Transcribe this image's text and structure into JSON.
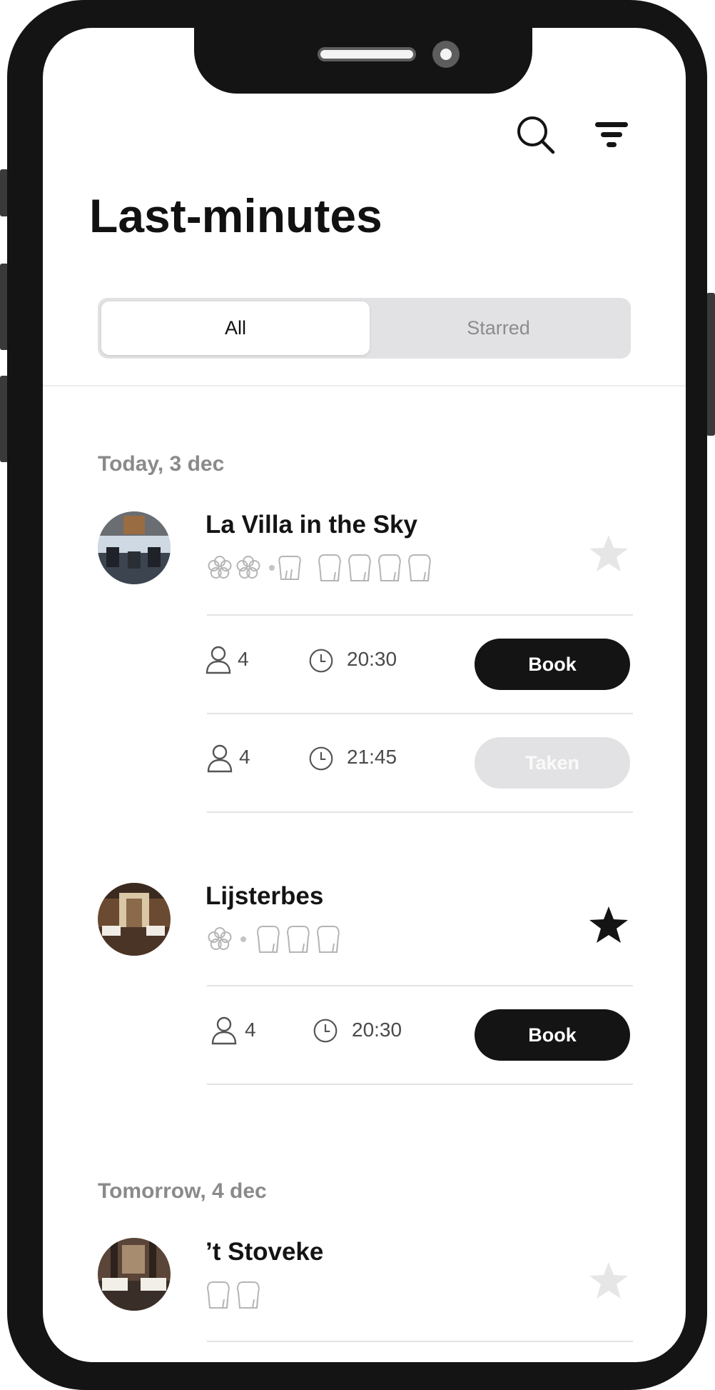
{
  "header": {
    "title": "Last-minutes",
    "search_icon": "search-icon",
    "filter_icon": "filter-icon"
  },
  "segmented_control": {
    "options": [
      "All",
      "Starred"
    ],
    "selected": "All"
  },
  "sections": [
    {
      "date_label": "Today, 3 dec",
      "restaurants": [
        {
          "name": "La Villa in the Sky",
          "michelin_stars": 2,
          "toques": 4,
          "starred": false,
          "slots": [
            {
              "guests": "4",
              "time": "20:30",
              "action": "Book",
              "available": true
            },
            {
              "guests": "4",
              "time": "21:45",
              "action": "Taken",
              "available": false
            }
          ]
        },
        {
          "name": "Lijsterbes",
          "michelin_stars": 1,
          "toques": 3,
          "starred": true,
          "slots": [
            {
              "guests": "4",
              "time": "20:30",
              "action": "Book",
              "available": true
            }
          ]
        }
      ]
    },
    {
      "date_label": "Tomorrow, 4 dec",
      "restaurants": [
        {
          "name": "’t Stoveke",
          "michelin_stars": 0,
          "toques": 2,
          "starred": false,
          "slots": []
        }
      ]
    }
  ],
  "colors": {
    "primary": "#141414",
    "muted_text": "#8a8a8a",
    "segment_bg": "#e2e2e4",
    "star_inactive": "#e6e6e6",
    "divider": "#e3e3e3"
  }
}
